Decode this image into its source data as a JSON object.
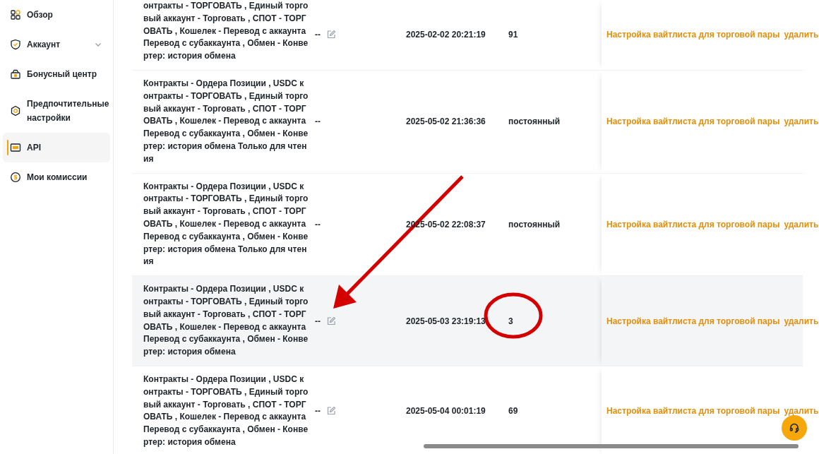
{
  "sidebar": {
    "items": [
      {
        "label": "Обзор",
        "selected": false
      },
      {
        "label": "Аккаунт",
        "selected": false,
        "expanded": false
      },
      {
        "label": "Бонусный центр",
        "selected": false
      },
      {
        "label": "Предпочтительные настройки",
        "selected": false
      },
      {
        "label": "API",
        "selected": true
      },
      {
        "label": "Мои комиссии",
        "selected": false
      }
    ]
  },
  "table": {
    "rows": [
      {
        "permissions": [
          "онтракты - ТОРГОВАТЬ , Единый торго",
          "вый аккаунт - Торговать , СПОТ - ТОРГ",
          "ОВАТЬ , Кошелек - Перевод с аккаунта",
          "Перевод с субаккаунта , Обмен - Конве",
          "ртер: история обмена"
        ],
        "note": "--",
        "editable": true,
        "created": "2025-02-02 20:21:19",
        "expiry": "91",
        "hovered": false,
        "actions": [
          "Настройка вайтлиста для торговой пары",
          "удалить"
        ]
      },
      {
        "permissions": [
          "Контракты - Ордера Позиции , USDC к",
          "онтракты - ТОРГОВАТЬ , Единый торго",
          "вый аккаунт - Торговать , СПОТ - ТОРГ",
          "ОВАТЬ , Кошелек - Перевод с аккаунта",
          "Перевод с субаккаунта , Обмен - Конве",
          "ртер: история обмена Только для чтен",
          "ия"
        ],
        "note": "--",
        "editable": false,
        "created": "2025-05-02 21:36:36",
        "expiry": "постоянный",
        "hovered": false,
        "actions": [
          "Настройка вайтлиста для торговой пары",
          "удалить"
        ]
      },
      {
        "permissions": [
          "Контракты - Ордера Позиции , USDC к",
          "онтракты - ТОРГОВАТЬ , Единый торго",
          "вый аккаунт - Торговать , СПОТ - ТОРГ",
          "ОВАТЬ , Кошелек - Перевод с аккаунта",
          "Перевод с субаккаунта , Обмен - Конве",
          "ртер: история обмена Только для чтен",
          "ия"
        ],
        "note": "--",
        "editable": false,
        "created": "2025-05-02 22:08:37",
        "expiry": "постоянный",
        "hovered": false,
        "actions": [
          "Настройка вайтлиста для торговой пары",
          "удалить"
        ]
      },
      {
        "permissions": [
          "Контракты - Ордера Позиции , USDC к",
          "онтракты - ТОРГОВАТЬ , Единый торго",
          "вый аккаунт - Торговать , СПОТ - ТОРГ",
          "ОВАТЬ , Кошелек - Перевод с аккаунта",
          "Перевод с субаккаунта , Обмен - Конве",
          "ртер: история обмена"
        ],
        "note": "--",
        "editable": true,
        "created": "2025-05-03 23:19:13",
        "expiry": "3",
        "hovered": true,
        "actions": [
          "Настройка вайтлиста для торговой пары",
          "удалить"
        ]
      },
      {
        "permissions": [
          "Контракты - Ордера Позиции , USDC к",
          "онтракты - ТОРГОВАТЬ , Единый торго",
          "вый аккаунт - Торговать , СПОТ - ТОРГ",
          "ОВАТЬ , Кошелек - Перевод с аккаунта",
          "Перевод с субаккаунта , Обмен - Конве",
          "ртер: история обмена"
        ],
        "note": "--",
        "editable": true,
        "created": "2025-05-04 00:01:19",
        "expiry": "69",
        "hovered": false,
        "actions": [
          "Настройка вайтлиста для торговой пары",
          "удалить"
        ]
      }
    ]
  }
}
